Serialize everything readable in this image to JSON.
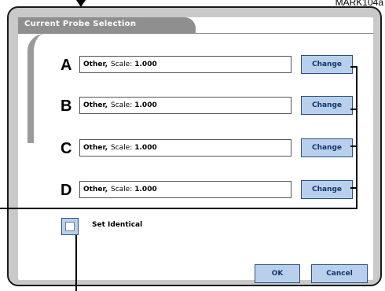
{
  "reference_label": "MARK104a",
  "panel": {
    "title": "Current Probe Selection"
  },
  "probes": [
    {
      "letter": "A",
      "name": "Other,",
      "scale_label": "Scale:",
      "scale_value": "1.000",
      "change_label": "Change"
    },
    {
      "letter": "B",
      "name": "Other,",
      "scale_label": "Scale:",
      "scale_value": "1.000",
      "change_label": "Change"
    },
    {
      "letter": "C",
      "name": "Other,",
      "scale_label": "Scale:",
      "scale_value": "1.000",
      "change_label": "Change"
    },
    {
      "letter": "D",
      "name": "Other,",
      "scale_label": "Scale:",
      "scale_value": "1.000",
      "change_label": "Change"
    }
  ],
  "set_identical": {
    "label": "Set Identical",
    "checked": false
  },
  "footer": {
    "ok_label": "OK",
    "cancel_label": "Cancel"
  },
  "colors": {
    "button_fill": "#b9d0ec",
    "button_border": "#2f4f82",
    "tab": "#8f8f8f",
    "bezel": "#c9c9c9"
  }
}
